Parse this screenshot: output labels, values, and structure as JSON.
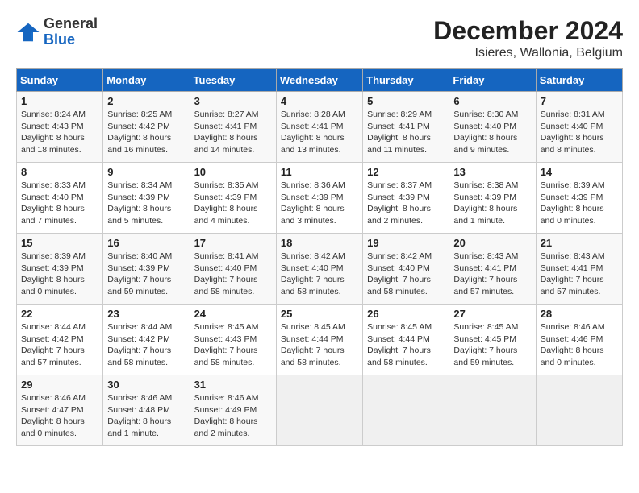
{
  "header": {
    "logo_general": "General",
    "logo_blue": "Blue",
    "title": "December 2024",
    "subtitle": "Isieres, Wallonia, Belgium"
  },
  "days_of_week": [
    "Sunday",
    "Monday",
    "Tuesday",
    "Wednesday",
    "Thursday",
    "Friday",
    "Saturday"
  ],
  "weeks": [
    [
      {
        "day": "1",
        "sunrise": "8:24 AM",
        "sunset": "4:43 PM",
        "daylight": "8 hours and 18 minutes."
      },
      {
        "day": "2",
        "sunrise": "8:25 AM",
        "sunset": "4:42 PM",
        "daylight": "8 hours and 16 minutes."
      },
      {
        "day": "3",
        "sunrise": "8:27 AM",
        "sunset": "4:41 PM",
        "daylight": "8 hours and 14 minutes."
      },
      {
        "day": "4",
        "sunrise": "8:28 AM",
        "sunset": "4:41 PM",
        "daylight": "8 hours and 13 minutes."
      },
      {
        "day": "5",
        "sunrise": "8:29 AM",
        "sunset": "4:41 PM",
        "daylight": "8 hours and 11 minutes."
      },
      {
        "day": "6",
        "sunrise": "8:30 AM",
        "sunset": "4:40 PM",
        "daylight": "8 hours and 9 minutes."
      },
      {
        "day": "7",
        "sunrise": "8:31 AM",
        "sunset": "4:40 PM",
        "daylight": "8 hours and 8 minutes."
      }
    ],
    [
      {
        "day": "8",
        "sunrise": "8:33 AM",
        "sunset": "4:40 PM",
        "daylight": "8 hours and 7 minutes."
      },
      {
        "day": "9",
        "sunrise": "8:34 AM",
        "sunset": "4:39 PM",
        "daylight": "8 hours and 5 minutes."
      },
      {
        "day": "10",
        "sunrise": "8:35 AM",
        "sunset": "4:39 PM",
        "daylight": "8 hours and 4 minutes."
      },
      {
        "day": "11",
        "sunrise": "8:36 AM",
        "sunset": "4:39 PM",
        "daylight": "8 hours and 3 minutes."
      },
      {
        "day": "12",
        "sunrise": "8:37 AM",
        "sunset": "4:39 PM",
        "daylight": "8 hours and 2 minutes."
      },
      {
        "day": "13",
        "sunrise": "8:38 AM",
        "sunset": "4:39 PM",
        "daylight": "8 hours and 1 minute."
      },
      {
        "day": "14",
        "sunrise": "8:39 AM",
        "sunset": "4:39 PM",
        "daylight": "8 hours and 0 minutes."
      }
    ],
    [
      {
        "day": "15",
        "sunrise": "8:39 AM",
        "sunset": "4:39 PM",
        "daylight": "8 hours and 0 minutes."
      },
      {
        "day": "16",
        "sunrise": "8:40 AM",
        "sunset": "4:39 PM",
        "daylight": "7 hours and 59 minutes."
      },
      {
        "day": "17",
        "sunrise": "8:41 AM",
        "sunset": "4:40 PM",
        "daylight": "7 hours and 58 minutes."
      },
      {
        "day": "18",
        "sunrise": "8:42 AM",
        "sunset": "4:40 PM",
        "daylight": "7 hours and 58 minutes."
      },
      {
        "day": "19",
        "sunrise": "8:42 AM",
        "sunset": "4:40 PM",
        "daylight": "7 hours and 58 minutes."
      },
      {
        "day": "20",
        "sunrise": "8:43 AM",
        "sunset": "4:41 PM",
        "daylight": "7 hours and 57 minutes."
      },
      {
        "day": "21",
        "sunrise": "8:43 AM",
        "sunset": "4:41 PM",
        "daylight": "7 hours and 57 minutes."
      }
    ],
    [
      {
        "day": "22",
        "sunrise": "8:44 AM",
        "sunset": "4:42 PM",
        "daylight": "7 hours and 57 minutes."
      },
      {
        "day": "23",
        "sunrise": "8:44 AM",
        "sunset": "4:42 PM",
        "daylight": "7 hours and 58 minutes."
      },
      {
        "day": "24",
        "sunrise": "8:45 AM",
        "sunset": "4:43 PM",
        "daylight": "7 hours and 58 minutes."
      },
      {
        "day": "25",
        "sunrise": "8:45 AM",
        "sunset": "4:44 PM",
        "daylight": "7 hours and 58 minutes."
      },
      {
        "day": "26",
        "sunrise": "8:45 AM",
        "sunset": "4:44 PM",
        "daylight": "7 hours and 58 minutes."
      },
      {
        "day": "27",
        "sunrise": "8:45 AM",
        "sunset": "4:45 PM",
        "daylight": "7 hours and 59 minutes."
      },
      {
        "day": "28",
        "sunrise": "8:46 AM",
        "sunset": "4:46 PM",
        "daylight": "8 hours and 0 minutes."
      }
    ],
    [
      {
        "day": "29",
        "sunrise": "8:46 AM",
        "sunset": "4:47 PM",
        "daylight": "8 hours and 0 minutes."
      },
      {
        "day": "30",
        "sunrise": "8:46 AM",
        "sunset": "4:48 PM",
        "daylight": "8 hours and 1 minute."
      },
      {
        "day": "31",
        "sunrise": "8:46 AM",
        "sunset": "4:49 PM",
        "daylight": "8 hours and 2 minutes."
      },
      null,
      null,
      null,
      null
    ]
  ]
}
